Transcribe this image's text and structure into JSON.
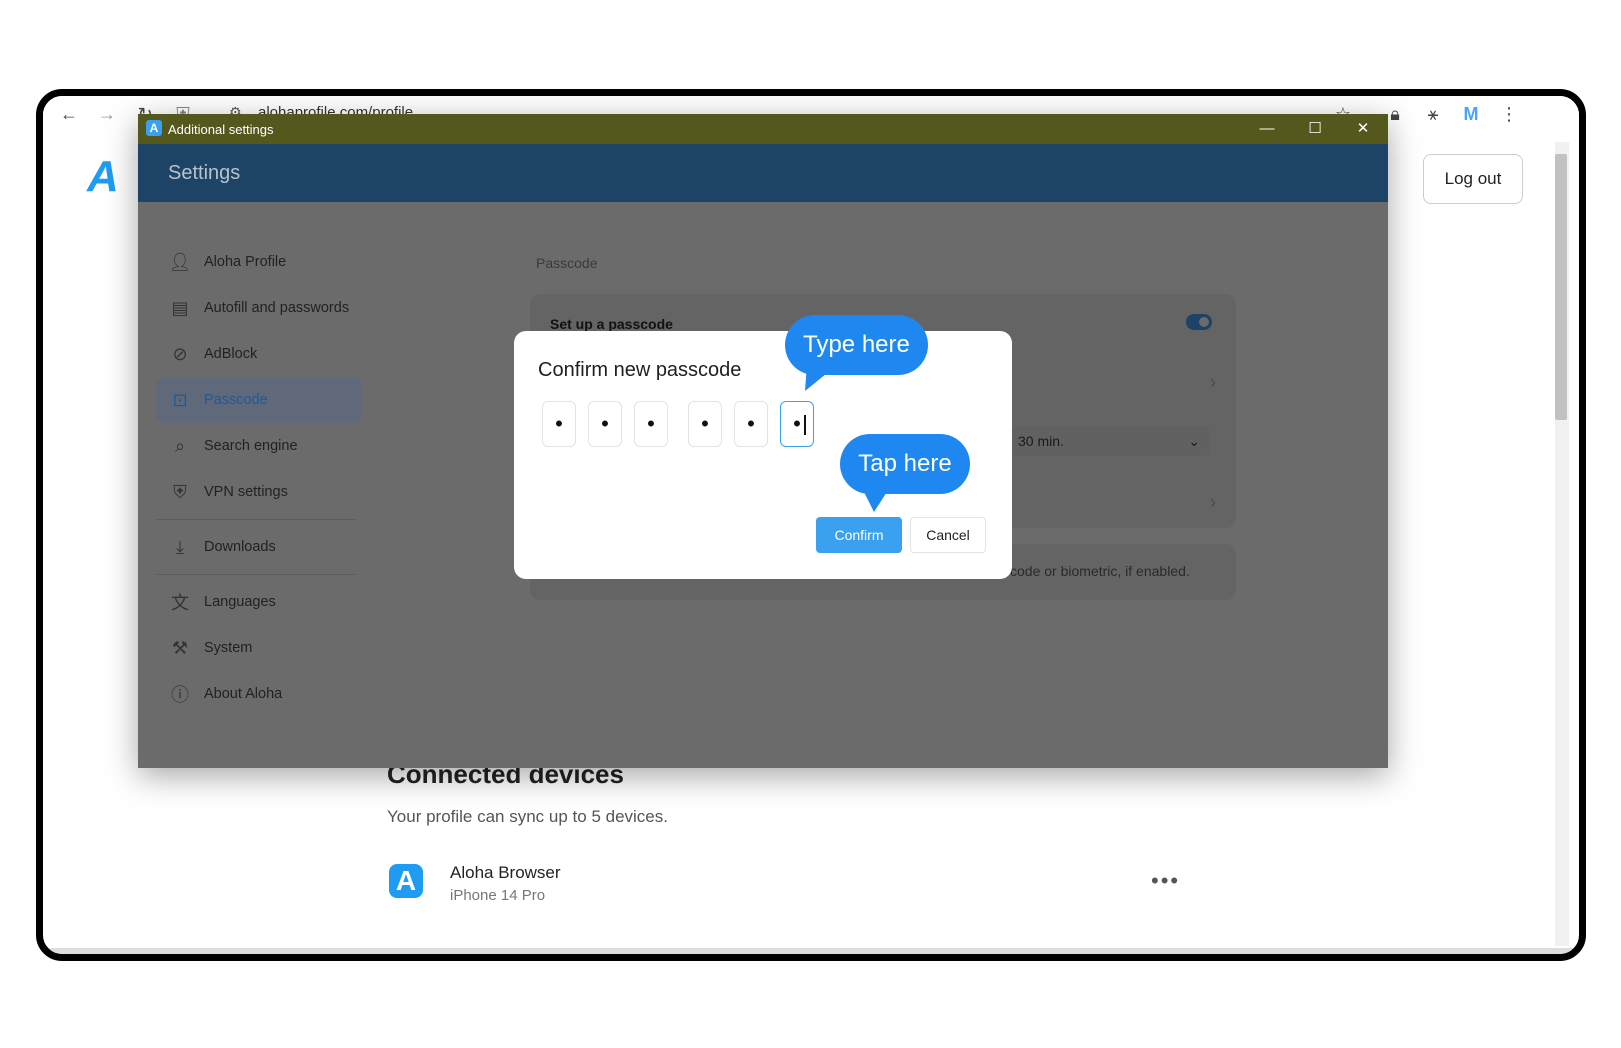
{
  "browser": {
    "url": "alohaprofile.com/profile",
    "profile_initial": "M",
    "icons": [
      "back-icon",
      "forward-icon",
      "reload-icon",
      "shield-icon",
      "site-settings-icon",
      "star-icon",
      "lock-icon",
      "extension-icon",
      "menu-icon"
    ]
  },
  "page": {
    "logo": "A",
    "logout_label": "Log out",
    "devices_heading": "Connected devices",
    "devices_sub": "Your profile can sync up to 5 devices.",
    "device": {
      "name": "Aloha Browser",
      "model": "iPhone 14 Pro",
      "more": "..."
    }
  },
  "window": {
    "title": "Additional settings",
    "app_icon": "A",
    "controls": {
      "minimize": "—",
      "maximize": "☐",
      "close": "✕"
    },
    "header": "Settings"
  },
  "nav": {
    "items": [
      {
        "label": "Aloha Profile",
        "icon": "user-icon"
      },
      {
        "label": "Autofill and passwords",
        "icon": "autofill-icon"
      },
      {
        "label": "AdBlock",
        "icon": "adblock-icon"
      },
      {
        "label": "Passcode",
        "icon": "passcode-icon",
        "active": true
      },
      {
        "label": "Search engine",
        "icon": "search-icon"
      },
      {
        "label": "VPN settings",
        "icon": "vpn-icon"
      },
      {
        "label": "Downloads",
        "icon": "download-icon"
      },
      {
        "label": "Languages",
        "icon": "languages-icon"
      },
      {
        "label": "System",
        "icon": "system-icon"
      },
      {
        "label": "About Aloha",
        "icon": "info-icon"
      }
    ]
  },
  "passcode_section": {
    "label": "Passcode",
    "setup_label": "Set up a passcode",
    "setup_enabled": true,
    "lock_timeout": "30 min.",
    "note_fragment": "code or biometric, if enabled."
  },
  "dialog": {
    "title": "Confirm new passcode",
    "digits": [
      "•",
      "•",
      "•",
      "•",
      "•",
      "•"
    ],
    "confirm_label": "Confirm",
    "cancel_label": "Cancel"
  },
  "callouts": {
    "type_here": "Type here",
    "tap_here": "Tap here",
    "color": "#1e87f0"
  },
  "colors": {
    "accent": "#3aa0f0",
    "titlebar": "#55581c",
    "header": "#1d4366"
  }
}
